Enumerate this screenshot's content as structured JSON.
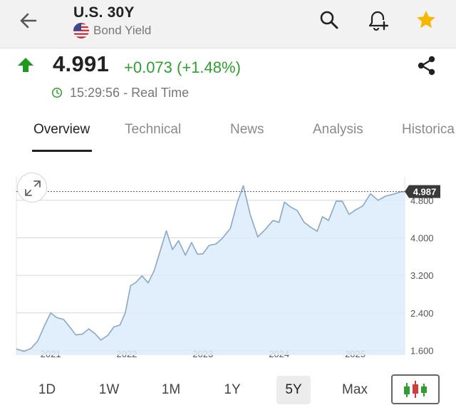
{
  "header": {
    "title": "U.S. 30Y",
    "subtitle": "Bond Yield"
  },
  "quote": {
    "price": "4.991",
    "change": "+0.073 (+1.48%)",
    "time": "15:29:56 - Real Time"
  },
  "tabs": [
    {
      "label": "Overview",
      "active": true
    },
    {
      "label": "Technical",
      "active": false
    },
    {
      "label": "News",
      "active": false
    },
    {
      "label": "Analysis",
      "active": false
    },
    {
      "label": "Historica",
      "active": false
    }
  ],
  "ranges": [
    {
      "label": "1D",
      "active": false
    },
    {
      "label": "1W",
      "active": false
    },
    {
      "label": "1M",
      "active": false
    },
    {
      "label": "1Y",
      "active": false
    },
    {
      "label": "5Y",
      "active": true
    },
    {
      "label": "Max",
      "active": false
    }
  ],
  "colors": {
    "accent_green": "#2e9f2e",
    "star": "#f5b800",
    "line": "#8aa8c4",
    "area": "#dcebfa"
  },
  "icons": [
    "back-arrow-icon",
    "us-flag-icon",
    "search-icon",
    "add-alert-icon",
    "star-icon",
    "up-arrow-icon",
    "share-icon",
    "clock-icon",
    "expand-icon",
    "candlestick-icon"
  ],
  "chart_data": {
    "type": "area",
    "current_value_label": "4.987",
    "ylim": [
      1.5,
      5.3
    ],
    "y_ticks": [
      {
        "value": 1.6,
        "label": "1.600"
      },
      {
        "value": 2.4,
        "label": "2.400"
      },
      {
        "value": 3.2,
        "label": "3.200"
      },
      {
        "value": 4.0,
        "label": "4.000"
      },
      {
        "value": 4.8,
        "label": "4.800"
      }
    ],
    "xlim": [
      2020.55,
      2025.65
    ],
    "x_ticks": [
      {
        "value": 2021.0,
        "label": "2021"
      },
      {
        "value": 2022.0,
        "label": "2022"
      },
      {
        "value": 2023.0,
        "label": "2023"
      },
      {
        "value": 2024.0,
        "label": "2024"
      },
      {
        "value": 2025.0,
        "label": "2025"
      }
    ],
    "points": [
      [
        2020.55,
        1.63
      ],
      [
        2020.65,
        1.58
      ],
      [
        2020.74,
        1.64
      ],
      [
        2020.83,
        1.8
      ],
      [
        2020.92,
        2.13
      ],
      [
        2021.0,
        2.4
      ],
      [
        2021.08,
        2.3
      ],
      [
        2021.17,
        2.26
      ],
      [
        2021.25,
        2.1
      ],
      [
        2021.33,
        1.93
      ],
      [
        2021.42,
        1.95
      ],
      [
        2021.5,
        2.06
      ],
      [
        2021.58,
        1.96
      ],
      [
        2021.66,
        1.82
      ],
      [
        2021.75,
        1.92
      ],
      [
        2021.83,
        2.1
      ],
      [
        2021.91,
        2.14
      ],
      [
        2021.98,
        2.4
      ],
      [
        2022.05,
        2.98
      ],
      [
        2022.12,
        3.05
      ],
      [
        2022.2,
        3.19
      ],
      [
        2022.28,
        3.04
      ],
      [
        2022.36,
        3.3
      ],
      [
        2022.45,
        3.78
      ],
      [
        2022.52,
        4.15
      ],
      [
        2022.6,
        3.75
      ],
      [
        2022.68,
        3.94
      ],
      [
        2022.77,
        3.63
      ],
      [
        2022.85,
        3.9
      ],
      [
        2022.93,
        3.65
      ],
      [
        2023.0,
        3.66
      ],
      [
        2023.08,
        3.84
      ],
      [
        2023.17,
        3.87
      ],
      [
        2023.25,
        3.98
      ],
      [
        2023.36,
        4.2
      ],
      [
        2023.45,
        4.75
      ],
      [
        2023.53,
        5.11
      ],
      [
        2023.62,
        4.5
      ],
      [
        2023.72,
        4.02
      ],
      [
        2023.82,
        4.18
      ],
      [
        2023.92,
        4.37
      ],
      [
        2024.0,
        4.33
      ],
      [
        2024.07,
        4.76
      ],
      [
        2024.15,
        4.66
      ],
      [
        2024.24,
        4.58
      ],
      [
        2024.33,
        4.33
      ],
      [
        2024.42,
        4.22
      ],
      [
        2024.5,
        4.14
      ],
      [
        2024.57,
        4.45
      ],
      [
        2024.65,
        4.37
      ],
      [
        2024.75,
        4.78
      ],
      [
        2024.83,
        4.78
      ],
      [
        2024.92,
        4.5
      ],
      [
        2025.0,
        4.59
      ],
      [
        2025.1,
        4.68
      ],
      [
        2025.2,
        4.94
      ],
      [
        2025.3,
        4.8
      ],
      [
        2025.4,
        4.89
      ],
      [
        2025.5,
        4.93
      ],
      [
        2025.6,
        4.98
      ],
      [
        2025.65,
        4.987
      ]
    ]
  }
}
